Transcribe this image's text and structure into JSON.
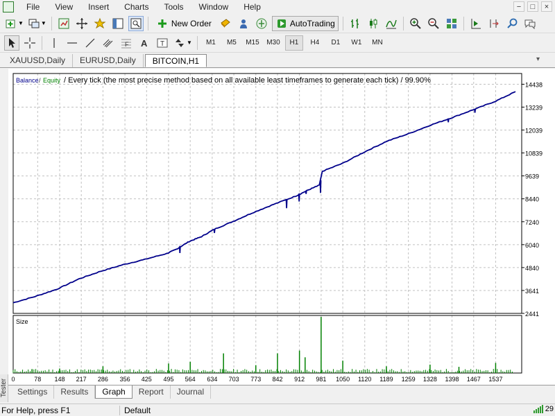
{
  "menu": {
    "items": [
      "File",
      "View",
      "Insert",
      "Charts",
      "Tools",
      "Window",
      "Help"
    ],
    "window_controls": [
      "−",
      "□",
      "×"
    ]
  },
  "toolbar": {
    "new_order_label": "New Order",
    "autotrading_label": "AutoTrading",
    "timeframes": [
      "M1",
      "M5",
      "M15",
      "M30",
      "H1",
      "H4",
      "D1",
      "W1",
      "MN"
    ],
    "active_timeframe": "H1"
  },
  "chart_tabs": {
    "items": [
      "XAUUSD,Daily",
      "EURUSD,Daily",
      "BITCOIN,H1"
    ],
    "active": "BITCOIN,H1",
    "dropdown_icon": "▾"
  },
  "chart_header": {
    "balance_label": "Balance",
    "separator": "/",
    "equity_label": "Equity",
    "description": "/ Every tick (the most precise method based on all available least timeframes to generate each tick) / 99.90%"
  },
  "chart_data": {
    "type": "line",
    "series": [
      {
        "name": "Balance",
        "x": [
          0,
          69,
          140,
          210,
          280,
          350,
          420,
          490,
          520,
          560,
          600,
          640,
          700,
          760,
          830,
          900,
          940,
          975,
          985,
          1050,
          1120,
          1190,
          1260,
          1330,
          1400,
          1470,
          1537,
          1600
        ],
        "values": [
          3000,
          3320,
          3710,
          4250,
          4650,
          4990,
          5270,
          5580,
          5800,
          6200,
          6460,
          6840,
          7250,
          7690,
          8150,
          8580,
          8900,
          9150,
          9880,
          10300,
          10900,
          11450,
          11850,
          12300,
          12700,
          13130,
          13550,
          14050
        ]
      },
      {
        "name": "Equity",
        "x": [
          0,
          69,
          140,
          210,
          280,
          350,
          420,
          490,
          520,
          560,
          600,
          640,
          700,
          760,
          830,
          900,
          940,
          975,
          985,
          1050,
          1120,
          1190,
          1260,
          1330,
          1400,
          1470,
          1537,
          1600
        ],
        "values": [
          3000,
          3320,
          3710,
          4250,
          4650,
          4990,
          5270,
          5580,
          5800,
          6200,
          6460,
          6840,
          7250,
          7690,
          8150,
          8580,
          8900,
          9150,
          9880,
          10300,
          10900,
          11450,
          11850,
          12300,
          12700,
          13130,
          13550,
          14050
        ]
      }
    ],
    "dips": [
      {
        "x": 530,
        "value": 5600
      },
      {
        "x": 640,
        "value": 6650
      },
      {
        "x": 870,
        "value": 7950
      },
      {
        "x": 910,
        "value": 8300
      },
      {
        "x": 932,
        "value": 8700
      },
      {
        "x": 978,
        "value": 8750
      },
      {
        "x": 1385,
        "value": 12450
      },
      {
        "x": 1470,
        "value": 12950
      }
    ],
    "ylim": [
      2441,
      15000
    ],
    "y_ticks": [
      "14438",
      "13239",
      "12039",
      "10839",
      "9639",
      "8440",
      "7240",
      "6040",
      "4840",
      "3641",
      "2441"
    ],
    "y_tick_values": [
      14438,
      13239,
      12039,
      10839,
      9639,
      8440,
      7240,
      6040,
      4840,
      3641,
      2441
    ],
    "x_ticks": [
      "0",
      "78",
      "148",
      "217",
      "286",
      "356",
      "425",
      "495",
      "564",
      "634",
      "703",
      "773",
      "842",
      "912",
      "981",
      "1050",
      "1120",
      "1189",
      "1259",
      "1328",
      "1398",
      "1467",
      "1537"
    ],
    "x_tick_values": [
      0,
      78,
      148,
      217,
      286,
      356,
      425,
      495,
      564,
      634,
      703,
      773,
      842,
      912,
      981,
      1050,
      1120,
      1189,
      1259,
      1328,
      1398,
      1467,
      1537
    ],
    "xlim": [
      0,
      1620
    ],
    "grid": true,
    "colors": {
      "balance": "#00008b",
      "equity": "#008000",
      "size": "#008000",
      "grid": "#c0c0c0"
    },
    "size_panel": {
      "label": "Size",
      "bars": [
        {
          "x": 981,
          "value": 1.0
        },
        {
          "x": 912,
          "value": 0.4
        },
        {
          "x": 842,
          "value": 0.35
        },
        {
          "x": 670,
          "value": 0.35
        },
        {
          "x": 930,
          "value": 0.28
        },
        {
          "x": 1050,
          "value": 0.22
        },
        {
          "x": 564,
          "value": 0.2
        },
        {
          "x": 1537,
          "value": 0.18
        },
        {
          "x": 495,
          "value": 0.17
        },
        {
          "x": 1328,
          "value": 0.15
        },
        {
          "x": 286,
          "value": 0.12
        },
        {
          "x": 773,
          "value": 0.14
        },
        {
          "x": 1189,
          "value": 0.12
        },
        {
          "x": 1420,
          "value": 0.11
        },
        {
          "x": 148,
          "value": 0.08
        },
        {
          "x": 60,
          "value": 0.07
        }
      ]
    }
  },
  "tester": {
    "strip_label": "Tester",
    "tabs": [
      "Settings",
      "Results",
      "Graph",
      "Report",
      "Journal"
    ],
    "active_tab": "Graph"
  },
  "status": {
    "help": "For Help, press F1",
    "profile": "Default",
    "connection": "29"
  }
}
